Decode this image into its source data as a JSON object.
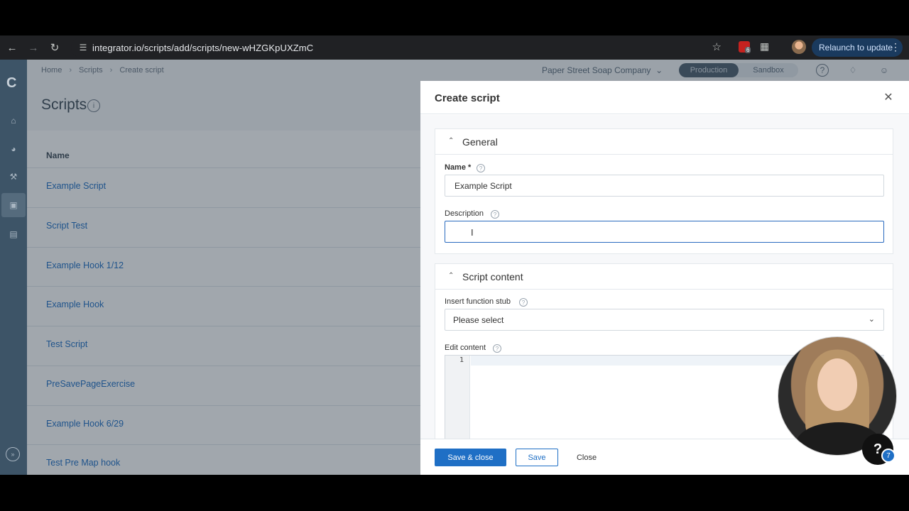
{
  "browser": {
    "url": "integrator.io/scripts/add/scripts/new-wHZGKpUXZmC",
    "relaunch_label": "Relaunch to update",
    "extension_badge": "6"
  },
  "topbar": {
    "breadcrumbs": [
      "Home",
      "Scripts",
      "Create script"
    ],
    "account": "Paper Street Soap Company",
    "env_options": [
      "Production",
      "Sandbox"
    ],
    "active_env": "Production"
  },
  "page": {
    "title": "Scripts",
    "column_header": "Name",
    "rows": [
      "Example Script",
      "Script Test",
      "Example Hook 1/12",
      "Example Hook",
      "Test Script",
      "PreSavePageExercise",
      "Example Hook 6/29",
      "Test Pre Map hook"
    ]
  },
  "drawer": {
    "title": "Create script",
    "general": {
      "section_title": "General",
      "name_label": "Name *",
      "name_value": "Example Script",
      "description_label": "Description",
      "description_value": ""
    },
    "content": {
      "section_title": "Script content",
      "stub_label": "Insert function stub",
      "stub_value": "Please select",
      "edit_label": "Edit content",
      "line_number": "1"
    },
    "footer": {
      "save_close": "Save & close",
      "save": "Save",
      "close": "Close"
    }
  },
  "help": {
    "badge_count": "7"
  },
  "colors": {
    "accent": "#1f6fc5",
    "sidebar": "#3d5467"
  }
}
